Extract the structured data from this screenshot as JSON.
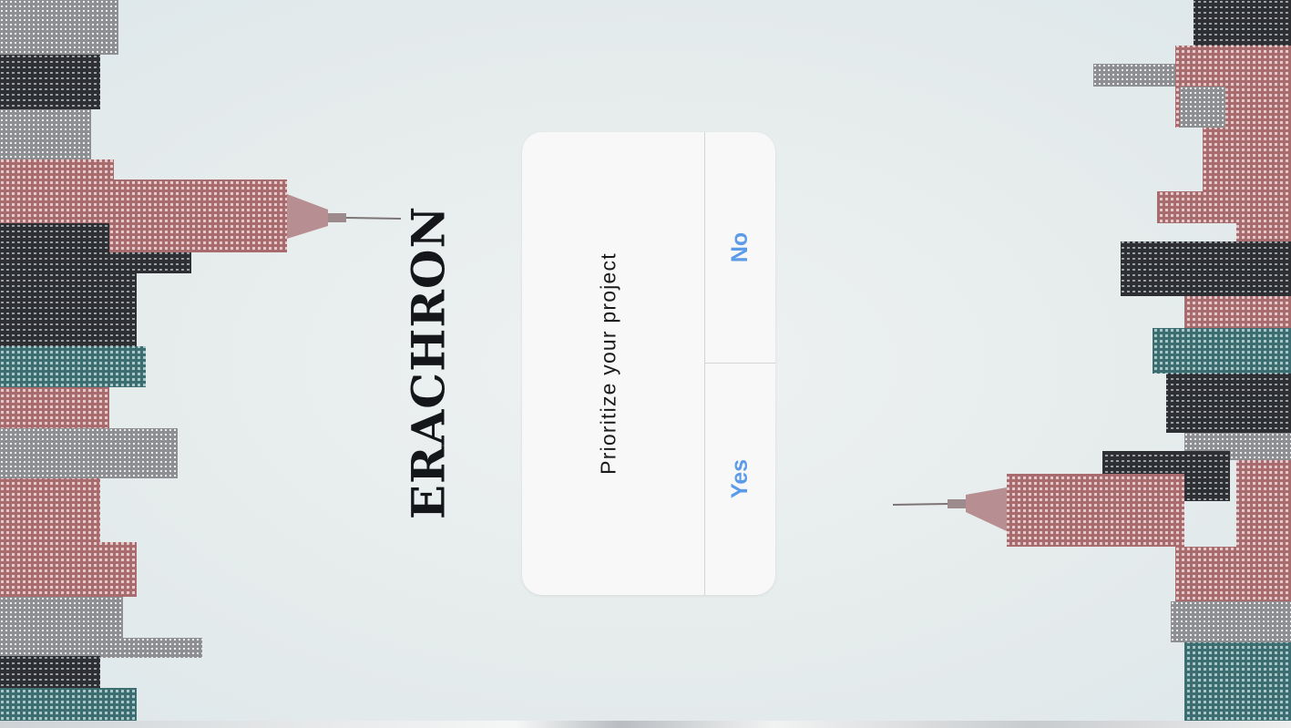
{
  "app": {
    "brand": "ERACHRON"
  },
  "dialog": {
    "message": "Prioritize your project",
    "no_label": "No",
    "yes_label": "Yes"
  },
  "colors": {
    "accent": "#5b9be8",
    "dialog_bg": "#f8f8f8",
    "divider": "#d2d4d6",
    "brand_text": "#15161a",
    "sky": "#e8eded"
  },
  "background": {
    "description_icon": "city-skyline-image"
  }
}
